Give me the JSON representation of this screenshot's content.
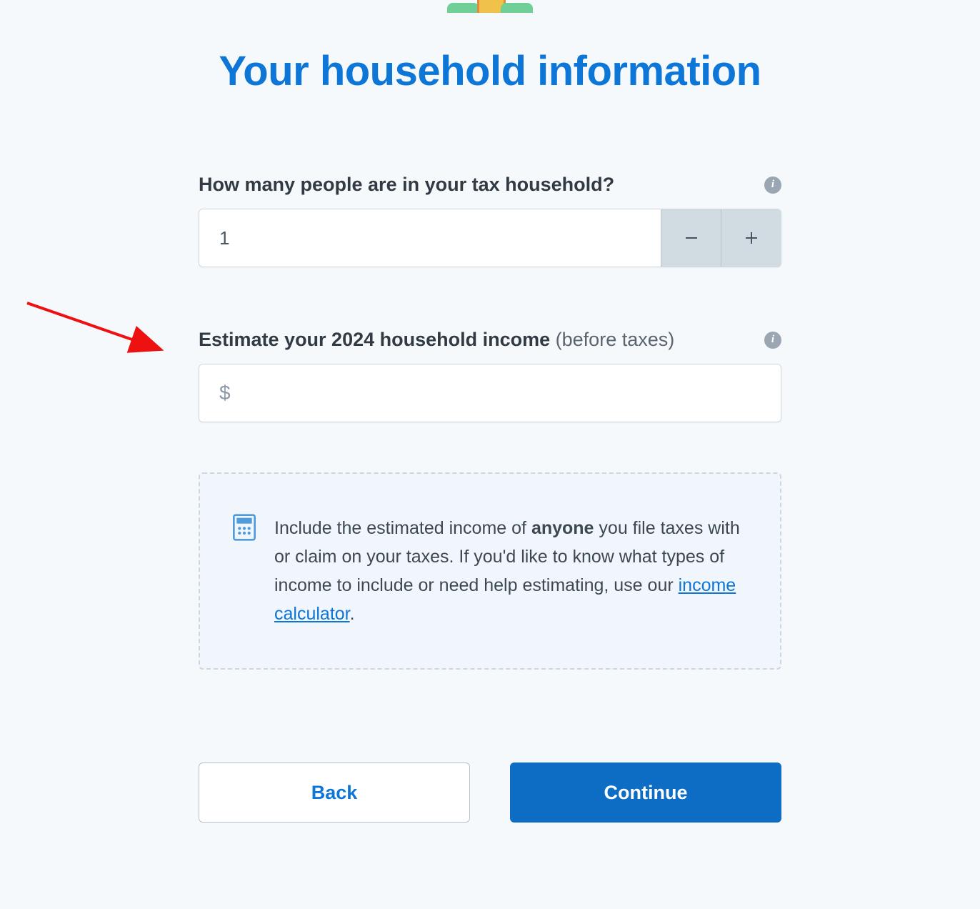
{
  "page": {
    "title": "Your household information"
  },
  "household": {
    "question": "How many people are in your tax household?",
    "value": "1"
  },
  "income": {
    "label_strong": "Estimate your 2024 household income",
    "label_sub": " (before taxes)",
    "currency_symbol": "$",
    "value": ""
  },
  "tip": {
    "text_before": "Include the estimated income of ",
    "text_strong": "anyone",
    "text_after": " you file taxes with or claim on your taxes. If you'd like to know what types of income to include or need help estimating, use our ",
    "link_text": "income calculator",
    "text_end": "."
  },
  "buttons": {
    "back": "Back",
    "continue": "Continue"
  },
  "icons": {
    "info": "i"
  }
}
